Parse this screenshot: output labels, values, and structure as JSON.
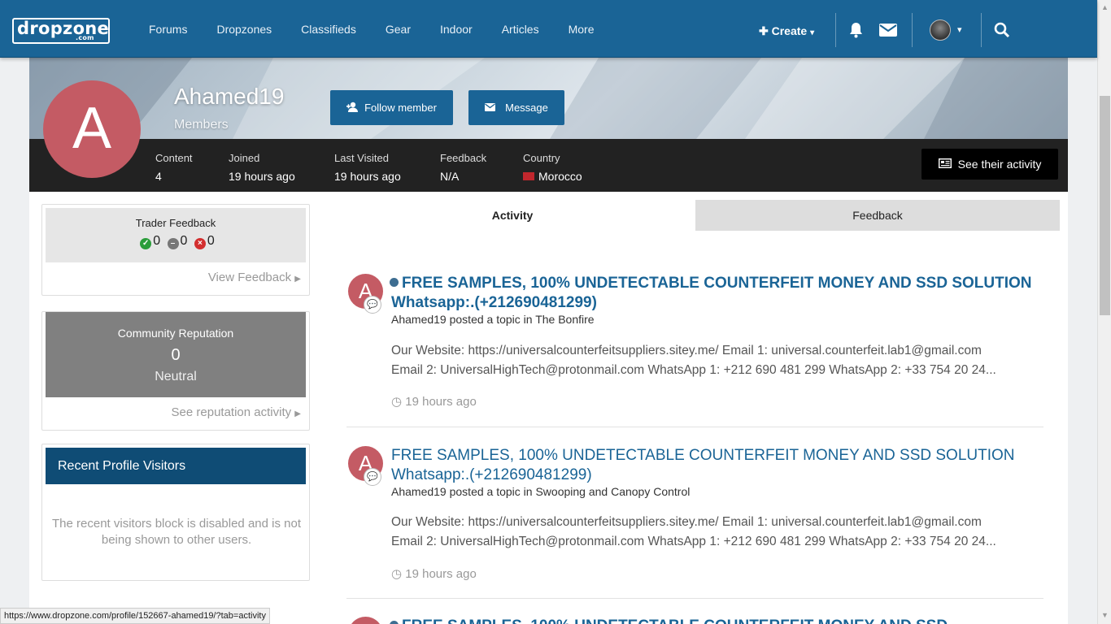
{
  "nav": {
    "logo": "dropzone",
    "logo_sub": ".com",
    "links": [
      "Forums",
      "Dropzones",
      "Classifieds",
      "Gear",
      "Indoor",
      "Articles",
      "More"
    ],
    "create": "Create"
  },
  "profile": {
    "initial": "A",
    "name": "Ahamed19",
    "group": "Members",
    "follow_label": "Follow member",
    "message_label": "Message",
    "activity_label": "See their activity",
    "stats": [
      {
        "label": "Content",
        "value": "4"
      },
      {
        "label": "Joined",
        "value": "19 hours ago"
      },
      {
        "label": "Last Visited",
        "value": "19 hours ago"
      },
      {
        "label": "Feedback",
        "value": "N/A"
      },
      {
        "label": "Country",
        "value": "Morocco"
      }
    ]
  },
  "sidebar": {
    "trader": {
      "title": "Trader Feedback",
      "positive": "0",
      "neutral": "0",
      "negative": "0",
      "link": "View Feedback"
    },
    "reputation": {
      "title": "Community Reputation",
      "value": "0",
      "level": "Neutral",
      "link": "See reputation activity"
    },
    "visitors": {
      "title": "Recent Profile Visitors",
      "message": "The recent visitors block is disabled and is not being shown to other users."
    }
  },
  "tabs": {
    "activity": "Activity",
    "feedback": "Feedback"
  },
  "posts": [
    {
      "title": "FREE SAMPLES, 100% UNDETECTABLE COUNTERFEIT MONEY AND SSD SOLUTION Whatsapp:.(+212690481299)",
      "meta": "Ahamed19 posted a topic in The Bonfire",
      "line1": "Our Website: https://universalcounterfeitsuppliers.sitey.me/ Email 1: universal.counterfeit.lab1@gmail.com",
      "line2": "Email 2: UniversalHighTech@protonmail.com WhatsApp 1: +212 690 481 299 WhatsApp 2: +33 754 20 24...",
      "time": "19 hours ago"
    },
    {
      "title": "FREE SAMPLES, 100% UNDETECTABLE COUNTERFEIT MONEY AND SSD SOLUTION Whatsapp:.(+212690481299)",
      "meta": "Ahamed19 posted a topic in Swooping and Canopy Control",
      "line1": "Our Website: https://universalcounterfeitsuppliers.sitey.me/ Email 1: universal.counterfeit.lab1@gmail.com",
      "line2": "Email 2: UniversalHighTech@protonmail.com WhatsApp 1: +212 690 481 299 WhatsApp 2: +33 754 20 24...",
      "time": "19 hours ago"
    },
    {
      "title": "FREE SAMPLES, 100% UNDETECTABLE COUNTERFEIT MONEY AND SSD"
    }
  ],
  "status_url": "https://www.dropzone.com/profile/152667-ahamed19/?tab=activity",
  "colors": {
    "nav": "#1a6496",
    "avatar": "#c45b64",
    "title_link": "#1a6496"
  }
}
